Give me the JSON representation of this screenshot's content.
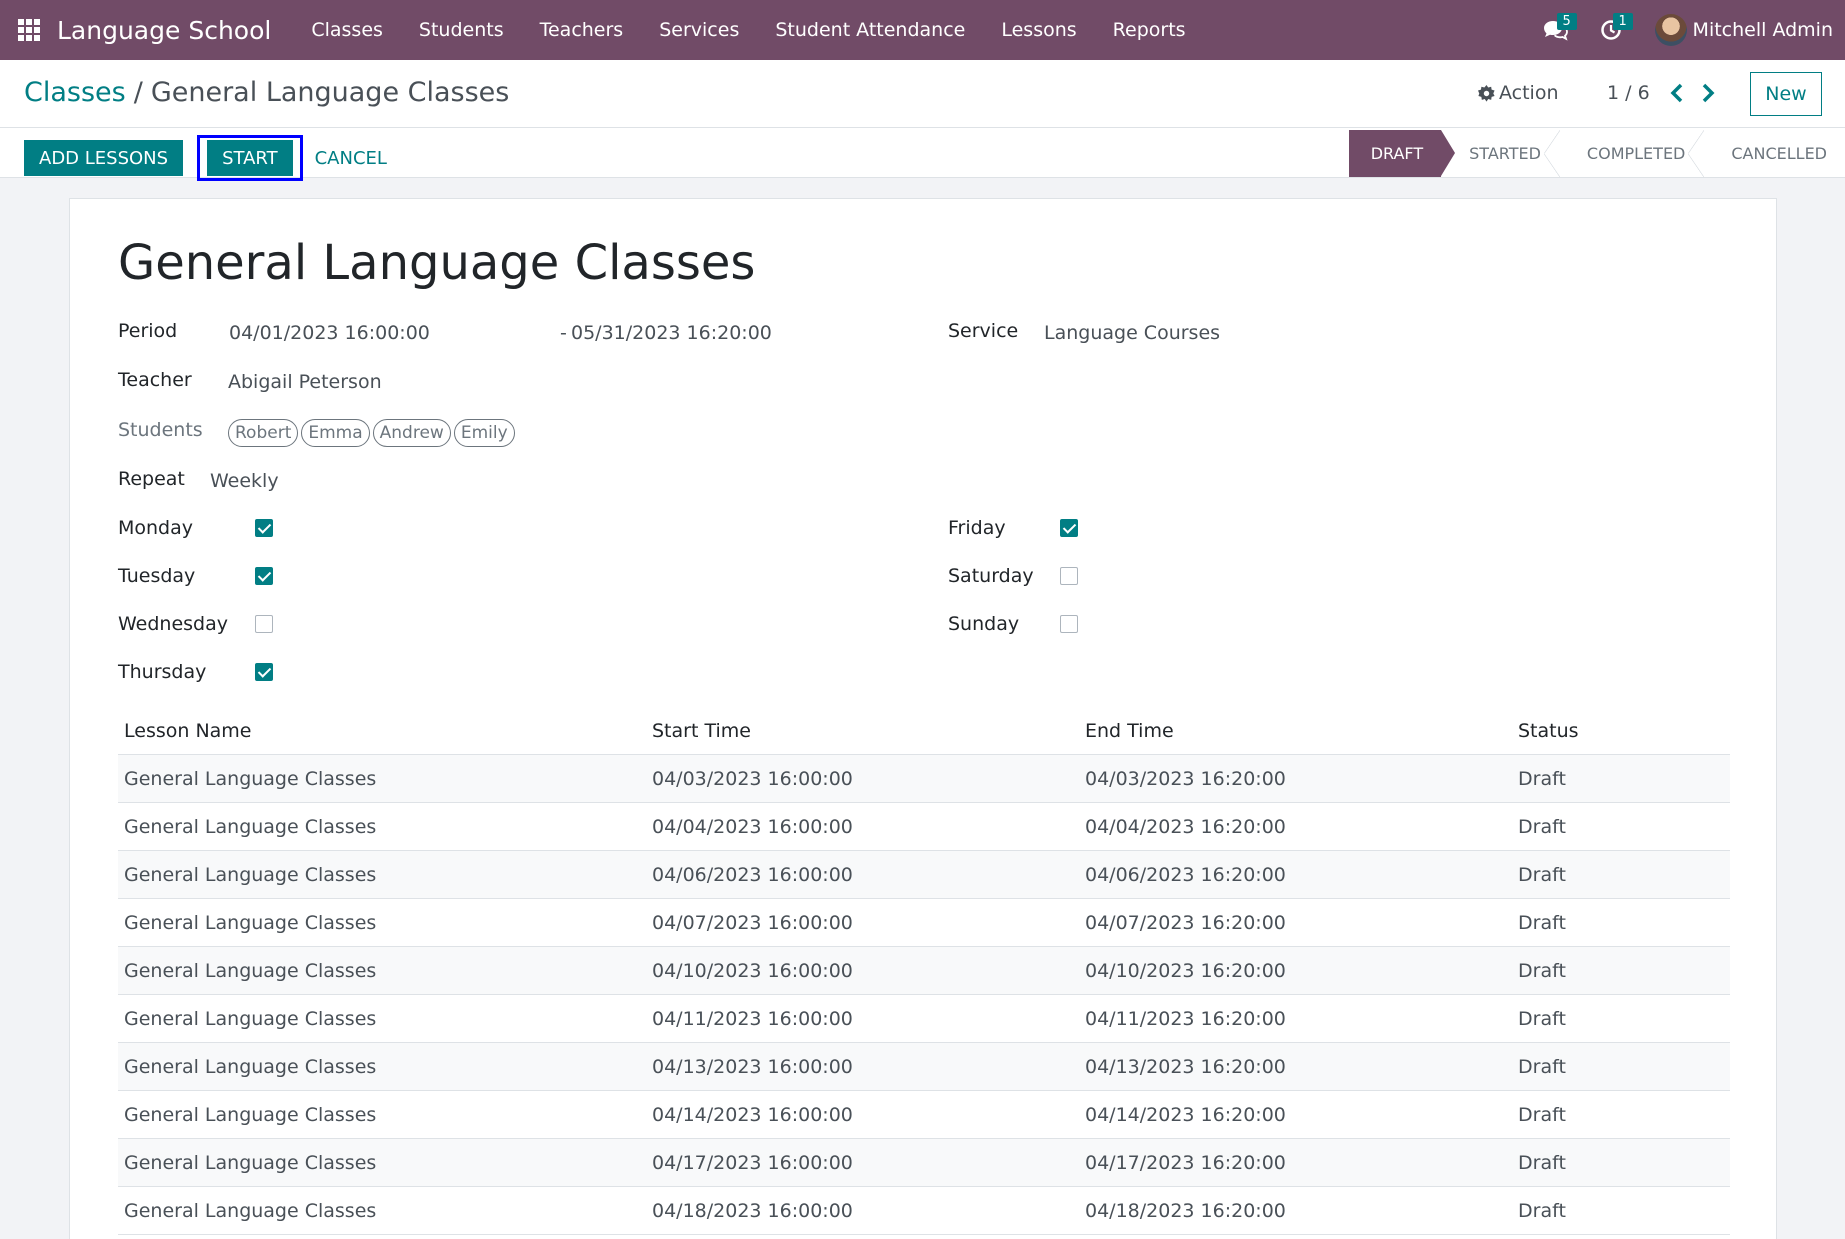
{
  "navbar": {
    "app_name": "Language School",
    "menu": [
      "Classes",
      "Students",
      "Teachers",
      "Services",
      "Student Attendance",
      "Lessons",
      "Reports"
    ],
    "messages_count": "5",
    "activities_count": "1",
    "user_name": "Mitchell Admin"
  },
  "breadcrumb": {
    "parent": "Classes",
    "separator": "/",
    "current": "General Language Classes"
  },
  "control": {
    "action_label": "Action",
    "pager": "1 / 6",
    "new_label": "New"
  },
  "buttons": {
    "add_lessons": "ADD LESSONS",
    "start": "START",
    "cancel": "CANCEL"
  },
  "statusbar": {
    "stages": [
      "DRAFT",
      "STARTED",
      "COMPLETED",
      "CANCELLED"
    ],
    "active": "DRAFT"
  },
  "form": {
    "title": "General Language Classes",
    "period_label": "Period",
    "period_start": "04/01/2023 16:00:00",
    "period_end": "05/31/2023 16:20:00",
    "period_dash": "-",
    "service_label": "Service",
    "service_value": "Language Courses",
    "teacher_label": "Teacher",
    "teacher_value": "Abigail Peterson",
    "students_label": "Students",
    "students": [
      "Robert",
      "Emma",
      "Andrew",
      "Emily"
    ],
    "repeat_label": "Repeat",
    "repeat_value": "Weekly",
    "days": {
      "monday": {
        "label": "Monday",
        "checked": true
      },
      "tuesday": {
        "label": "Tuesday",
        "checked": true
      },
      "wednesday": {
        "label": "Wednesday",
        "checked": false
      },
      "thursday": {
        "label": "Thursday",
        "checked": true
      },
      "friday": {
        "label": "Friday",
        "checked": true
      },
      "saturday": {
        "label": "Saturday",
        "checked": false
      },
      "sunday": {
        "label": "Sunday",
        "checked": false
      }
    }
  },
  "lessons": {
    "headers": [
      "Lesson Name",
      "Start Time",
      "End Time",
      "Status"
    ],
    "rows": [
      [
        "General Language Classes",
        "04/03/2023 16:00:00",
        "04/03/2023 16:20:00",
        "Draft"
      ],
      [
        "General Language Classes",
        "04/04/2023 16:00:00",
        "04/04/2023 16:20:00",
        "Draft"
      ],
      [
        "General Language Classes",
        "04/06/2023 16:00:00",
        "04/06/2023 16:20:00",
        "Draft"
      ],
      [
        "General Language Classes",
        "04/07/2023 16:00:00",
        "04/07/2023 16:20:00",
        "Draft"
      ],
      [
        "General Language Classes",
        "04/10/2023 16:00:00",
        "04/10/2023 16:20:00",
        "Draft"
      ],
      [
        "General Language Classes",
        "04/11/2023 16:00:00",
        "04/11/2023 16:20:00",
        "Draft"
      ],
      [
        "General Language Classes",
        "04/13/2023 16:00:00",
        "04/13/2023 16:20:00",
        "Draft"
      ],
      [
        "General Language Classes",
        "04/14/2023 16:00:00",
        "04/14/2023 16:20:00",
        "Draft"
      ],
      [
        "General Language Classes",
        "04/17/2023 16:00:00",
        "04/17/2023 16:20:00",
        "Draft"
      ],
      [
        "General Language Classes",
        "04/18/2023 16:00:00",
        "04/18/2023 16:20:00",
        "Draft"
      ]
    ]
  }
}
